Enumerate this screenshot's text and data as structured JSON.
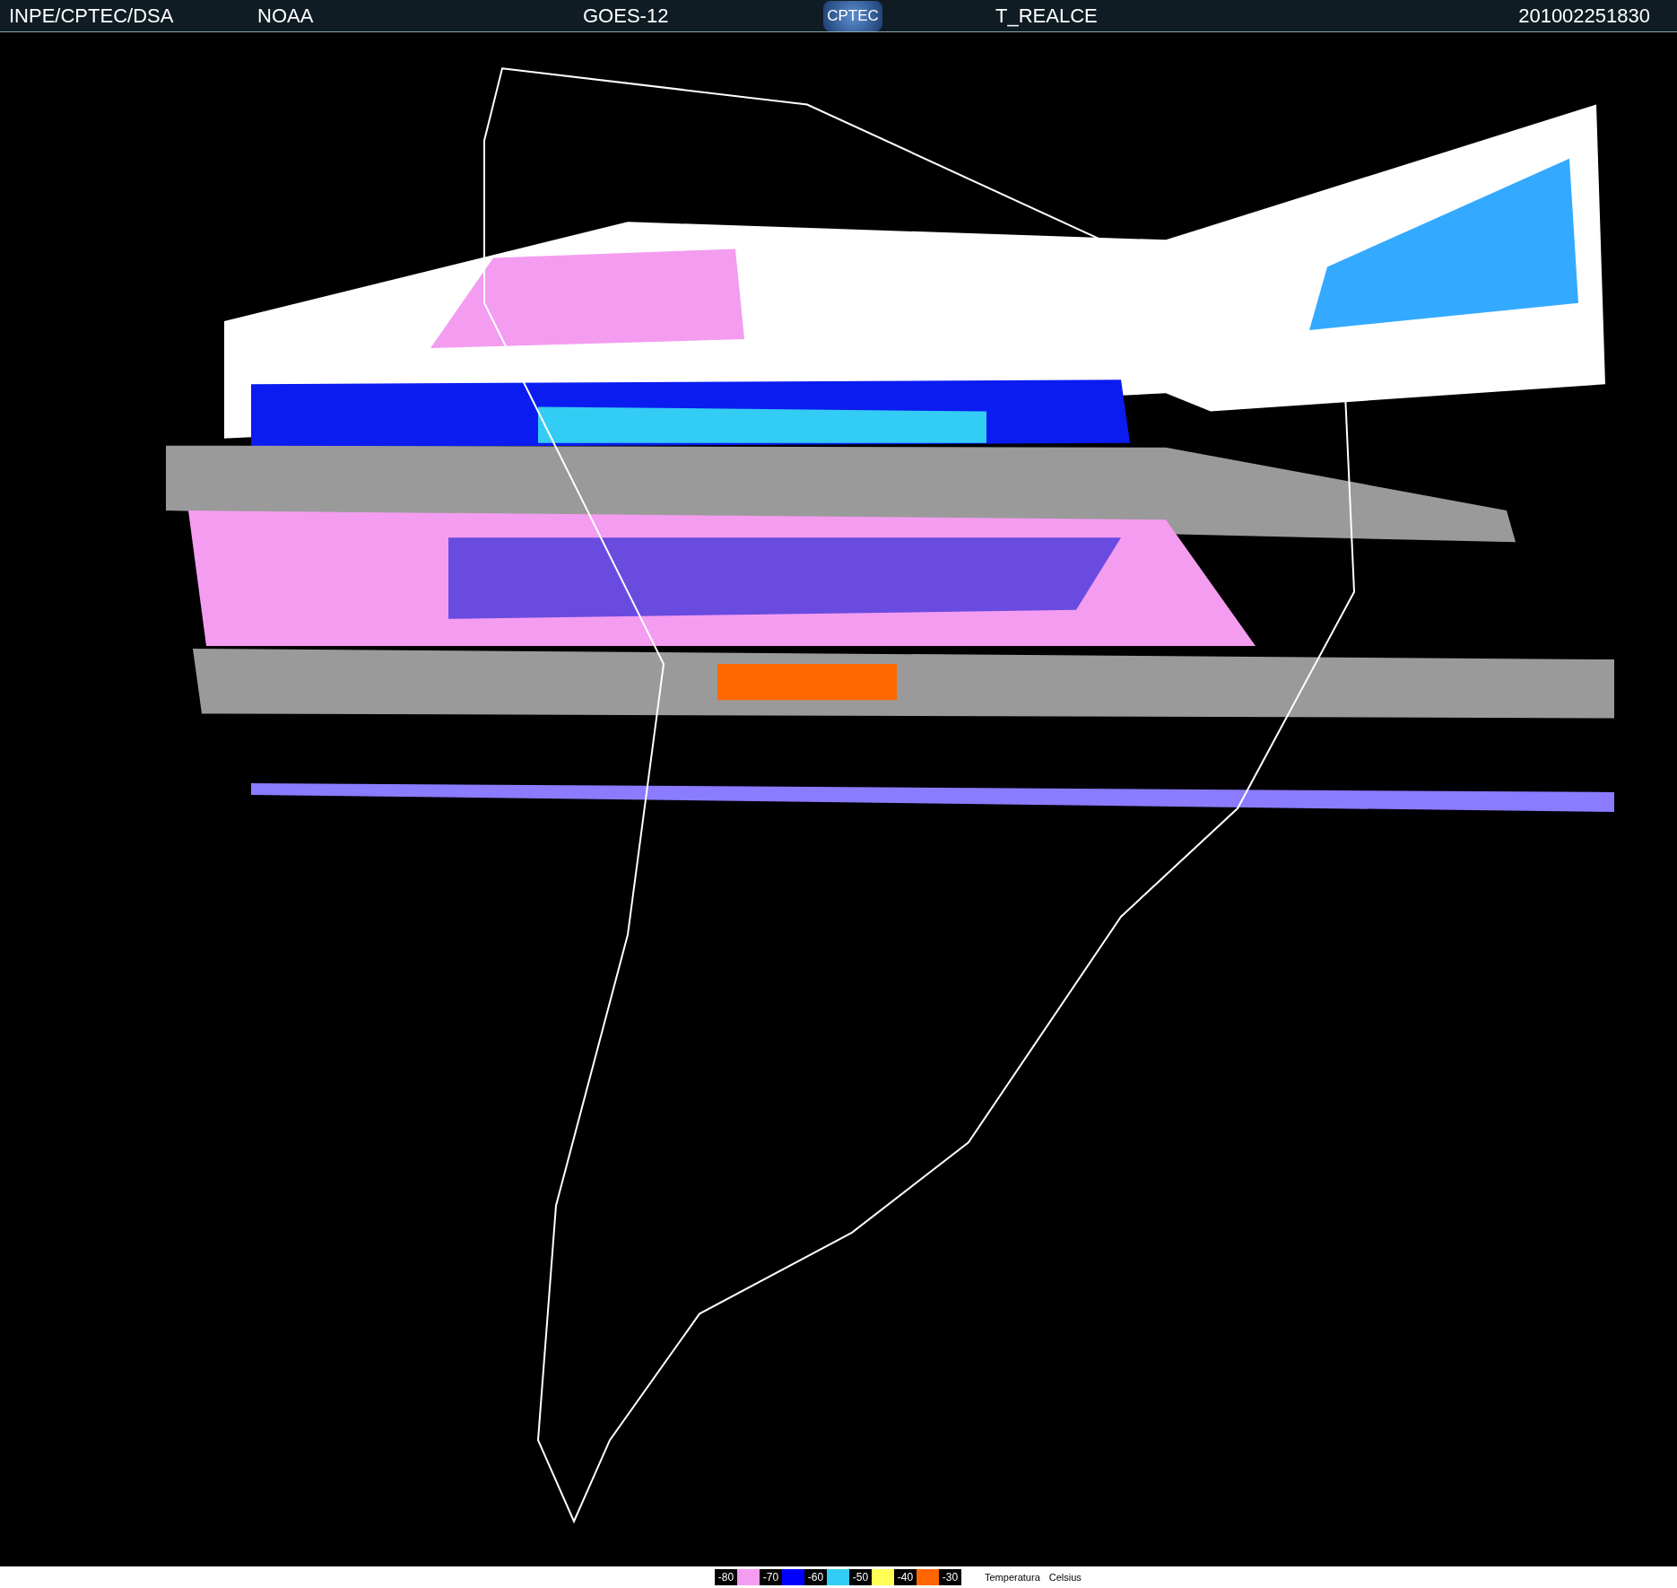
{
  "header": {
    "items": [
      "INPE/CPTEC/DSA",
      "NOAA",
      "GOES-12"
    ],
    "logo": "CPTEC",
    "product": "T_REALCE",
    "timestamp": "201002251830"
  },
  "legend": {
    "steps": [
      {
        "label": "-80",
        "color": "#f49cf0"
      },
      {
        "label": "-70",
        "color": "#0000ff"
      },
      {
        "label": "-60",
        "color": "#33ccf5"
      },
      {
        "label": "-50",
        "color": "#ffff55"
      },
      {
        "label": "-40",
        "color": "#ff6600"
      },
      {
        "label": "-30"
      }
    ],
    "caption": [
      "Temperatura",
      "Celsius"
    ]
  }
}
